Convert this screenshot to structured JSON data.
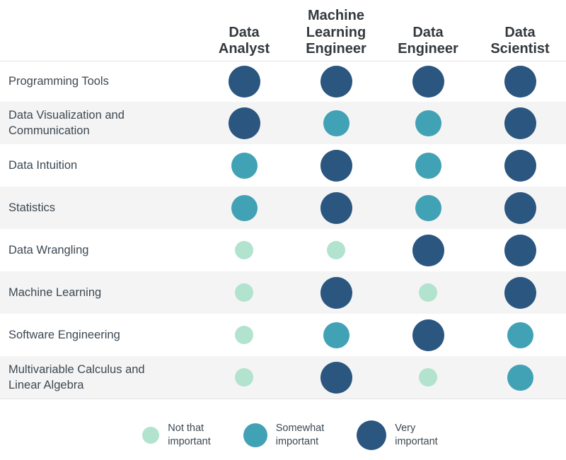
{
  "chart_data": {
    "type": "heatmap",
    "title": "",
    "subtitle": "",
    "xlabel": "",
    "ylabel": "",
    "grid": true,
    "legend_position": "bottom-center",
    "encoding": "dot size and color encode importance level",
    "categories": [
      "Data Analyst",
      "Machine Learning Engineer",
      "Data Engineer",
      "Data Scientist"
    ],
    "rows": [
      "Programming Tools",
      "Data Visualization and Communication",
      "Data Intuition",
      "Statistics",
      "Data Wrangling",
      "Machine Learning",
      "Software Engineering",
      "Multivariable Calculus and Linear Algebra"
    ],
    "levels": [
      {
        "value": 1,
        "label": "Not that important",
        "color": "#b2e3cf"
      },
      {
        "value": 2,
        "label": "Somewhat important",
        "color": "#41a1b5"
      },
      {
        "value": 3,
        "label": "Very important",
        "color": "#2b5680"
      }
    ],
    "values": [
      [
        3,
        3,
        3,
        3
      ],
      [
        3,
        2,
        2,
        3
      ],
      [
        2,
        3,
        2,
        3
      ],
      [
        2,
        3,
        2,
        3
      ],
      [
        1,
        1,
        3,
        3
      ],
      [
        1,
        3,
        1,
        3
      ],
      [
        1,
        2,
        3,
        2
      ],
      [
        1,
        3,
        1,
        2
      ]
    ],
    "series": [
      {
        "name": "Data Analyst",
        "values": [
          3,
          3,
          2,
          2,
          1,
          1,
          1,
          1
        ]
      },
      {
        "name": "Machine Learning Engineer",
        "values": [
          3,
          2,
          3,
          3,
          1,
          3,
          2,
          3
        ]
      },
      {
        "name": "Data Engineer",
        "values": [
          3,
          2,
          2,
          2,
          3,
          1,
          3,
          1
        ]
      },
      {
        "name": "Data Scientist",
        "values": [
          3,
          3,
          3,
          3,
          3,
          3,
          2,
          2
        ]
      }
    ]
  },
  "header": {
    "columns": [
      {
        "label": "Data\nAnalyst"
      },
      {
        "label": "Machine\nLearning\nEngineer"
      },
      {
        "label": "Data\nEngineer"
      },
      {
        "label": "Data\nScientist"
      }
    ]
  },
  "rows": [
    {
      "label": "Programming Tools"
    },
    {
      "label": "Data Visualization and\nCommunication"
    },
    {
      "label": "Data Intuition"
    },
    {
      "label": "Statistics"
    },
    {
      "label": "Data Wrangling"
    },
    {
      "label": "Machine Learning"
    },
    {
      "label": "Software Engineering"
    },
    {
      "label": "Multivariable Calculus and\nLinear Algebra"
    }
  ],
  "legend": {
    "items": [
      {
        "label": "Not that\nimportant",
        "level": 1,
        "color": "#b2e3cf"
      },
      {
        "label": "Somewhat\nimportant",
        "level": 2,
        "color": "#41a1b5"
      },
      {
        "label": "Very\nimportant",
        "level": 3,
        "color": "#2b5680"
      }
    ]
  },
  "colors": {
    "not_important": "#b2e3cf",
    "somewhat_important": "#41a1b5",
    "very_important": "#2b5680",
    "stripe": "#f4f4f4",
    "rule": "#e2e2e2",
    "text": "#3d4852",
    "header_text": "#33393f"
  }
}
